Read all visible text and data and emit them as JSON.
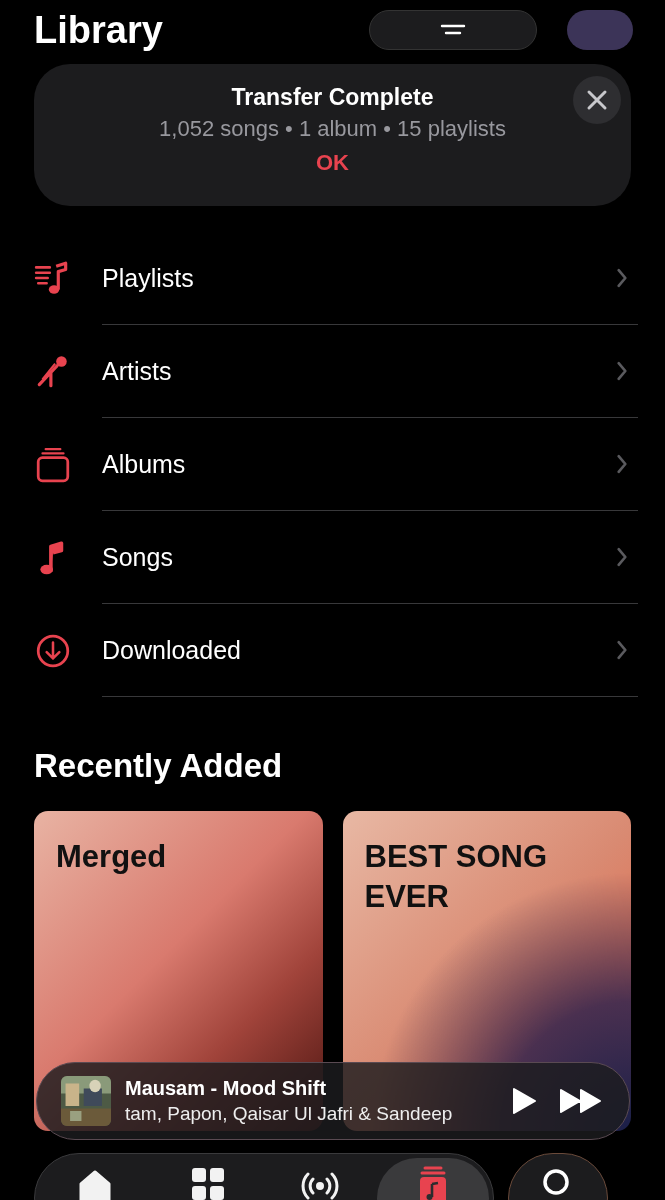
{
  "header": {
    "title": "Library"
  },
  "banner": {
    "title": "Transfer Complete",
    "details": "1,052 songs • 1 album • 15 playlists",
    "action": "OK"
  },
  "categories": [
    {
      "label": "Playlists",
      "kind": "playlists"
    },
    {
      "label": "Artists",
      "kind": "artists"
    },
    {
      "label": "Albums",
      "kind": "albums"
    },
    {
      "label": "Songs",
      "kind": "songs"
    },
    {
      "label": "Downloaded",
      "kind": "downloaded"
    }
  ],
  "recently_added": {
    "title": "Recently Added",
    "items": [
      {
        "title": "Merged",
        "kind": "ember"
      },
      {
        "title": "BEST SONG EVER",
        "kind": "dusk"
      }
    ]
  },
  "now_playing": {
    "title": "Mausam - Mood Shift",
    "artists": "tam, Papon, Qaisar Ul Jafri & Sandeep",
    "playing": false
  },
  "tabs": [
    {
      "kind": "home",
      "selected": false
    },
    {
      "kind": "browse",
      "selected": false
    },
    {
      "kind": "radio",
      "selected": false
    },
    {
      "kind": "library",
      "selected": true
    }
  ]
}
